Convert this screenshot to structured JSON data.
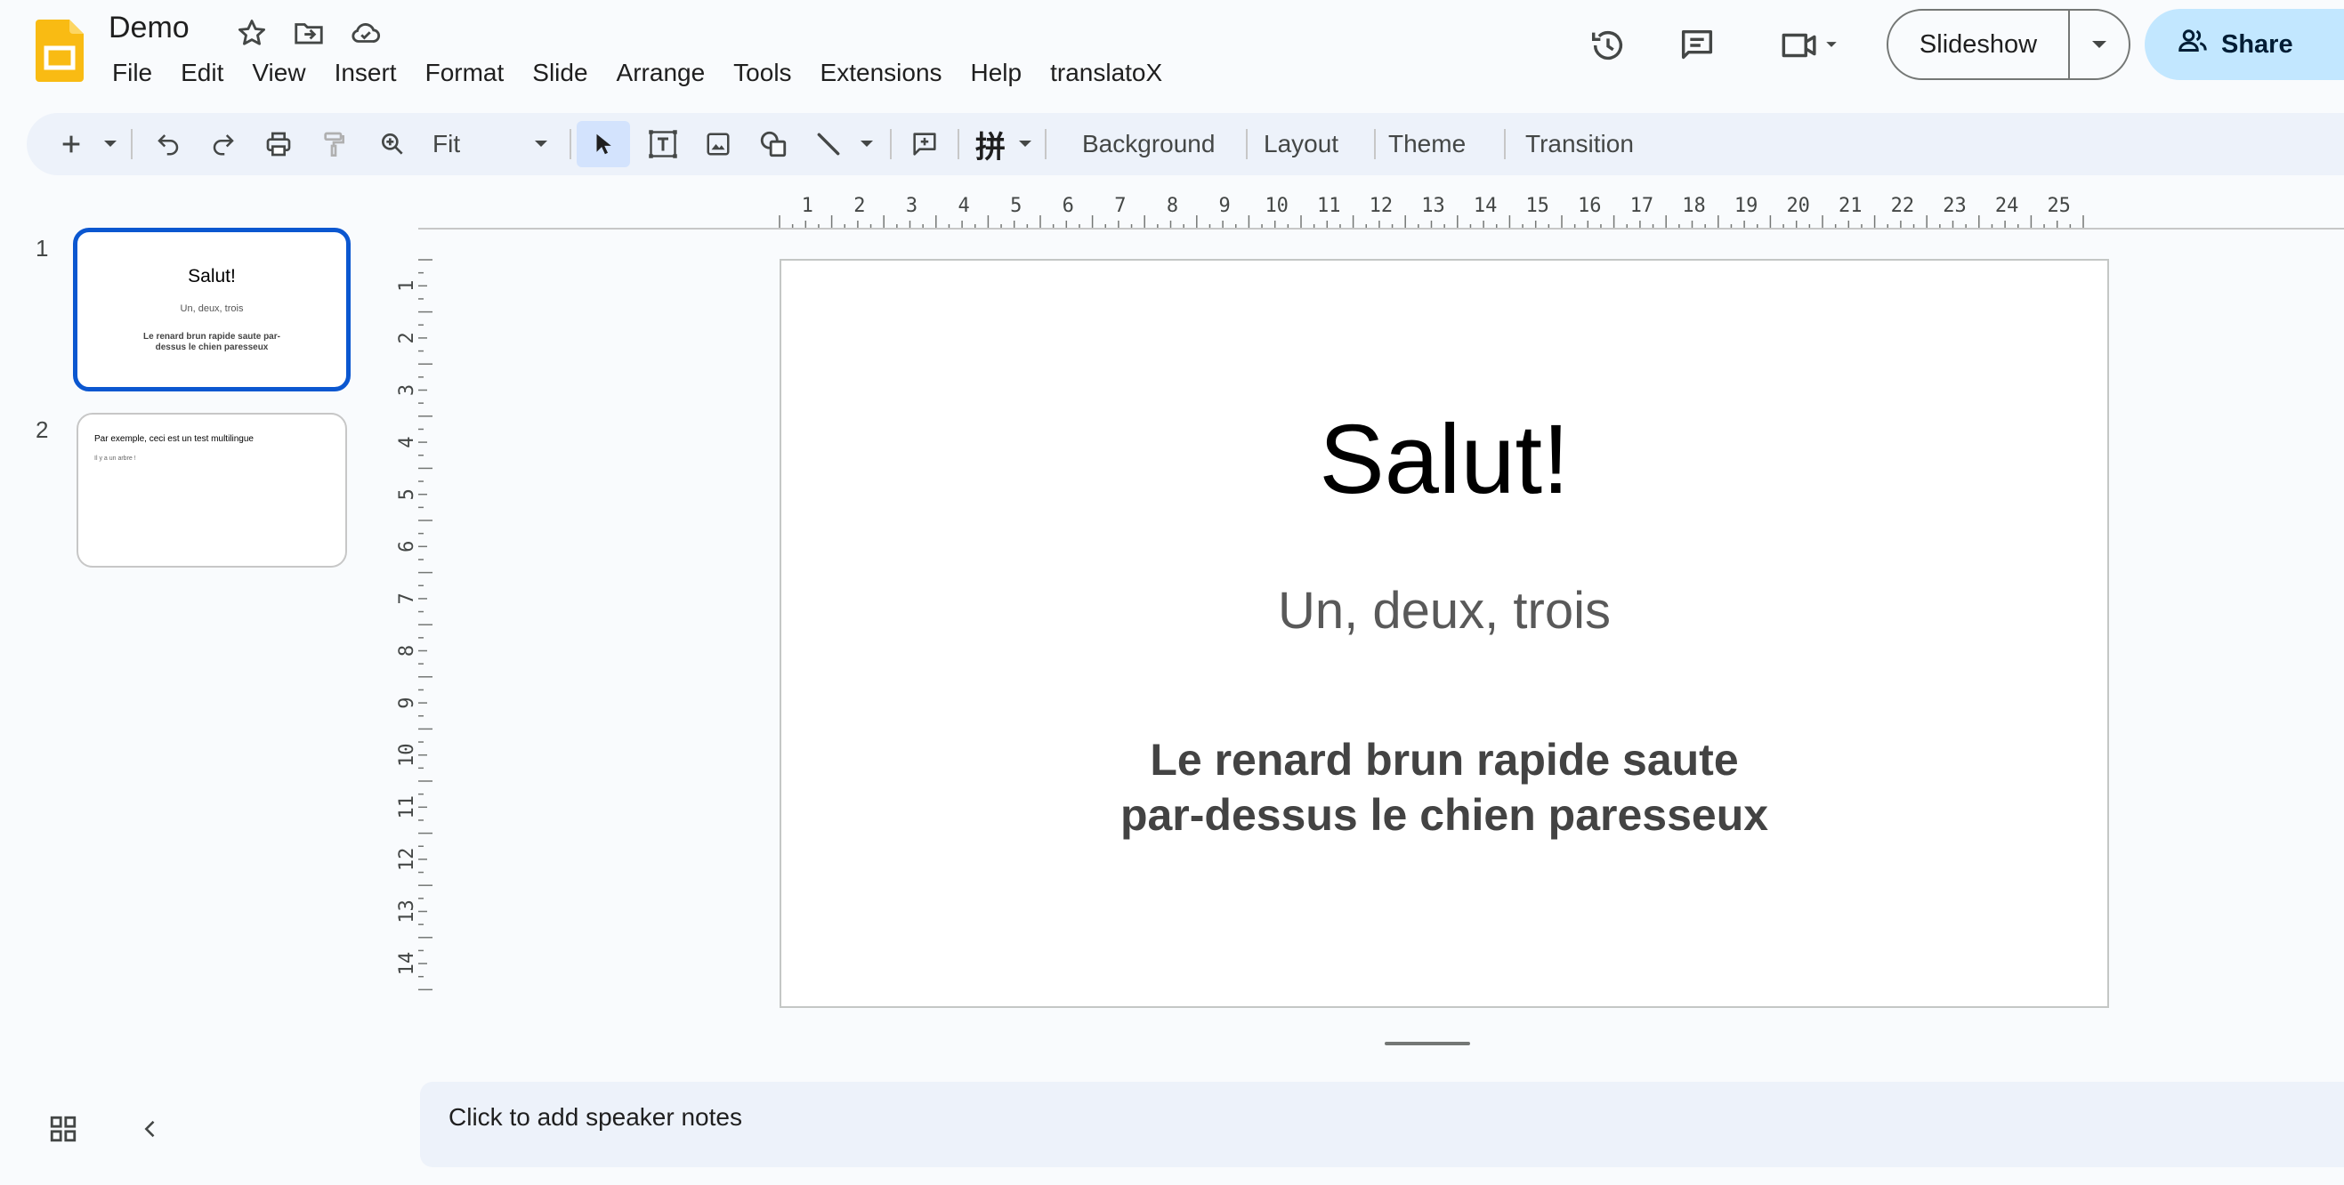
{
  "colors": {
    "accent": "#0b57d0",
    "share_bg": "#c2e7ff",
    "logo": "#f9bb13"
  },
  "doc": {
    "title": "Demo"
  },
  "menu": [
    "File",
    "Edit",
    "View",
    "Insert",
    "Format",
    "Slide",
    "Arrange",
    "Tools",
    "Extensions",
    "Help",
    "translatoX"
  ],
  "header": {
    "slideshow_label": "Slideshow",
    "share_label": "Share"
  },
  "toolbar": {
    "zoom_value": "Fit",
    "background_label": "Background",
    "layout_label": "Layout",
    "theme_label": "Theme",
    "transition_label": "Transition"
  },
  "filmstrip": [
    {
      "number": "1",
      "title": "Salut!",
      "subtitle": "Un, deux, trois",
      "body": "Le renard brun rapide saute par-dessus le chien paresseux"
    },
    {
      "number": "2",
      "title": "Par exemple, ceci est un test multilingue",
      "body": "Il y a un arbre !"
    }
  ],
  "ruler": {
    "horizontal": [
      "1",
      "2",
      "3",
      "4",
      "5",
      "6",
      "7",
      "8",
      "9",
      "10",
      "11",
      "12",
      "13",
      "14",
      "15",
      "16",
      "17",
      "18",
      "19",
      "20",
      "21",
      "22",
      "23",
      "24",
      "25"
    ],
    "vertical": [
      "1",
      "2",
      "3",
      "4",
      "5",
      "6",
      "7",
      "8",
      "9",
      "10",
      "11",
      "12",
      "13",
      "14"
    ]
  },
  "slide": {
    "title": "Salut!",
    "subtitle": "Un, deux, trois",
    "body": "Le renard brun rapide saute par-dessus le chien paresseux"
  },
  "notes": {
    "placeholder": "Click to add speaker notes"
  }
}
